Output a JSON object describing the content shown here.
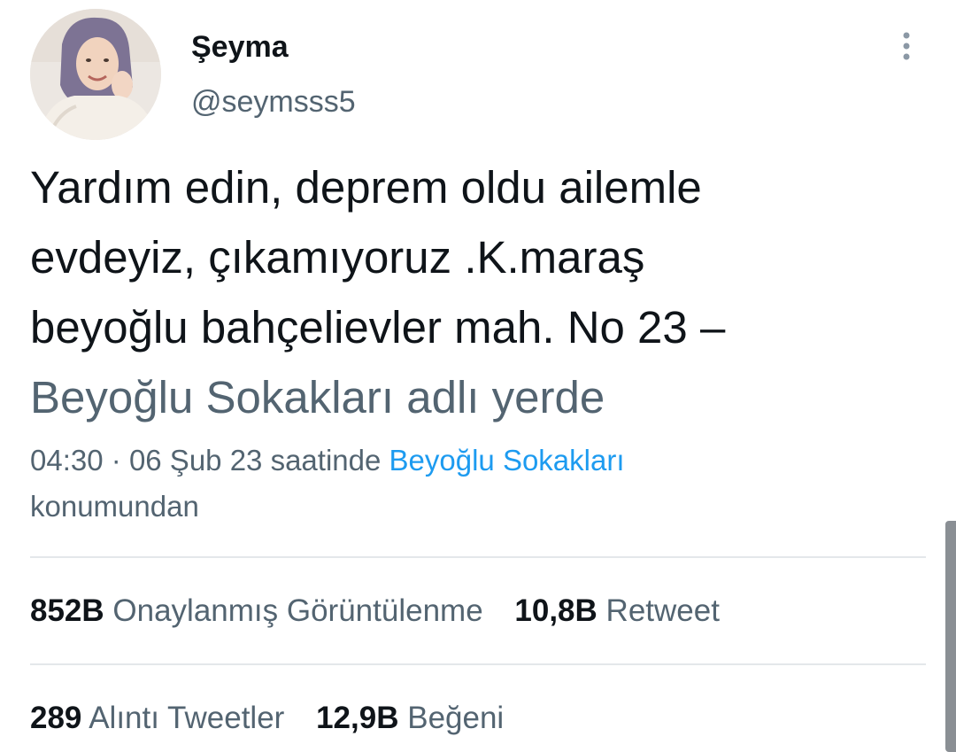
{
  "user": {
    "display_name": "Şeyma",
    "handle": "@seymsss5",
    "avatar_icon": "profile-photo"
  },
  "tweet": {
    "text_lines": [
      "Yardım edin, deprem oldu ailemle",
      "evdeyiz, çıkamıyoruz .K.maraş",
      "beyoğlu bahçelievler mah. No 23 –",
      "Beyoğlu Sokakları adlı yerde"
    ],
    "time": "04:30",
    "separator": "·",
    "date": "06 Şub 23",
    "location_prefix": "saatinde",
    "location_link": "Beyoğlu Sokakları",
    "location_suffix": "konumundan"
  },
  "stats": {
    "views": {
      "count": "852B",
      "label": "Onaylanmış Görüntülenme"
    },
    "retweets": {
      "count": "10,8B",
      "label": "Retweet"
    },
    "quotes": {
      "count": "289",
      "label": "Alıntı Tweetler"
    },
    "likes": {
      "count": "12,9B",
      "label": "Beğeni"
    }
  },
  "colors": {
    "link": "#1d9bf0",
    "secondary_text": "#536471",
    "primary_text": "#0f1419"
  }
}
